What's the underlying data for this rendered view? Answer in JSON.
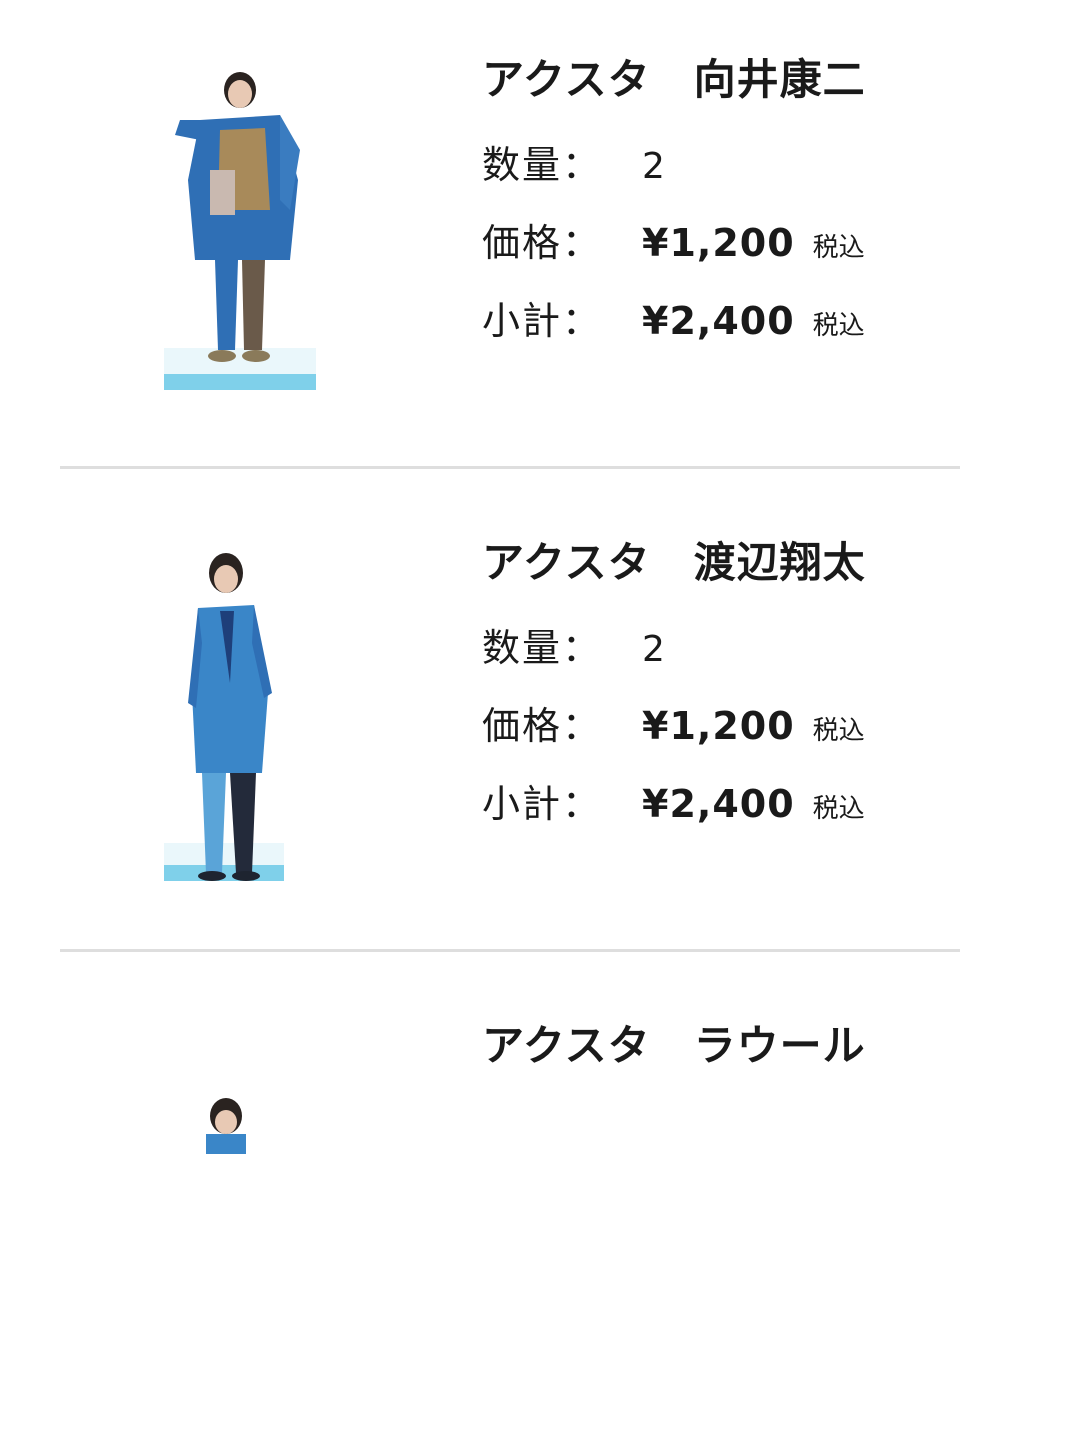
{
  "items": [
    {
      "name": "アクスタ　向井康二",
      "quantity_label": "数量：",
      "quantity": "2",
      "price_label": "価格：",
      "price": "¥1,200",
      "price_tax": "税込",
      "subtotal_label": "小計：",
      "subtotal": "¥2,400",
      "subtotal_tax": "税込"
    },
    {
      "name": "アクスタ　渡辺翔太",
      "quantity_label": "数量：",
      "quantity": "2",
      "price_label": "価格：",
      "price": "¥1,200",
      "price_tax": "税込",
      "subtotal_label": "小計：",
      "subtotal": "¥2,400",
      "subtotal_tax": "税込"
    },
    {
      "name": "アクスタ　ラウール"
    }
  ],
  "colors": {
    "text": "#1a1a1a",
    "divider": "#dedede",
    "suit_blue": "#2f6fb5",
    "stand_base": "#7fd0ea"
  }
}
